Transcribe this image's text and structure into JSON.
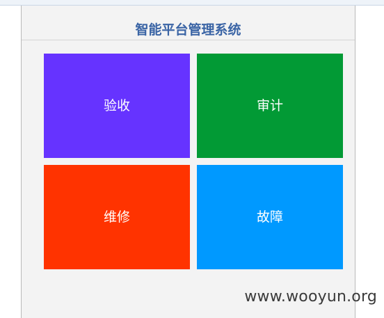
{
  "header": {
    "title": "智能平台管理系统"
  },
  "tiles": [
    {
      "label": "验收",
      "color": "#6633ff"
    },
    {
      "label": "审计",
      "color": "#029a35"
    },
    {
      "label": "维修",
      "color": "#ff3300"
    },
    {
      "label": "故障",
      "color": "#0099ff"
    }
  ],
  "watermark": {
    "text": "www.wooyun.org"
  },
  "colors": {
    "title": "#3a64a5",
    "panel_bg": "#f3f3f3",
    "tile_text": "#ffffff"
  }
}
